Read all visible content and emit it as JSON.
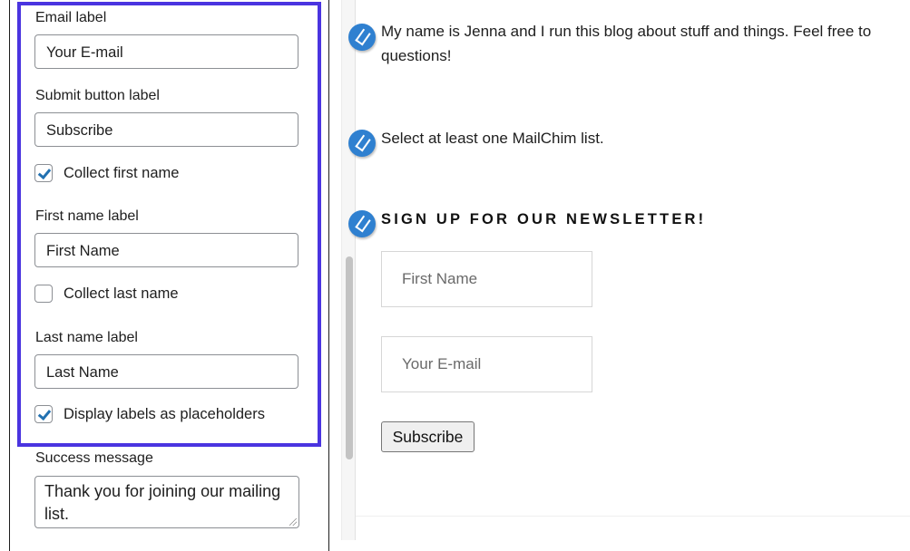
{
  "settings_panel": {
    "email_label": {
      "label": "Email label",
      "value": "Your E-mail"
    },
    "submit_label": {
      "label": "Submit button label",
      "value": "Subscribe"
    },
    "collect_first_name": {
      "label": "Collect first name",
      "checked": true
    },
    "first_name_label": {
      "label": "First name label",
      "value": "First Name"
    },
    "collect_last_name": {
      "label": "Collect last name",
      "checked": false
    },
    "last_name_label": {
      "label": "Last name label",
      "value": "Last Name"
    },
    "display_placeholders": {
      "label": "Display labels as placeholders",
      "checked": true
    },
    "success_message": {
      "label": "Success message",
      "value": "Thank you for joining our mailing list."
    },
    "highlight_color": "#4a34e0"
  },
  "preview": {
    "intro_text_line1": "My name is Jenna and I run this blog about stuff and things. Feel free to",
    "intro_text_line2": "questions!",
    "notice_text": "Select at least one MailChim list.",
    "newsletter_title": "SIGN UP FOR OUR NEWSLETTER!",
    "first_name_placeholder": "First Name",
    "email_placeholder": "Your E-mail",
    "subscribe_button": "Subscribe",
    "edit_icon_color": "#2f80d0"
  }
}
